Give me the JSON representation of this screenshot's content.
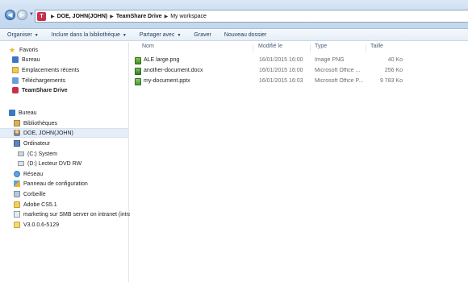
{
  "address": {
    "icon": "teamshare-icon",
    "crumbs": [
      "DOE, JOHN(JOHN)",
      "TeamShare Drive",
      "My workspace"
    ]
  },
  "toolbar": {
    "organise": "Organiser",
    "include_library": "Inclure dans la bibliothèque",
    "share_with": "Partager avec",
    "burn": "Graver",
    "new_folder": "Nouveau dossier"
  },
  "navigation": {
    "favorites": [
      {
        "label": "Favoris",
        "icon": "star-icon"
      },
      {
        "label": "Bureau",
        "icon": "desktop-icon"
      },
      {
        "label": "Emplacements récents",
        "icon": "recent-places-icon"
      },
      {
        "label": "Téléchargements",
        "icon": "downloads-icon"
      },
      {
        "label": "TeamShare Drive",
        "icon": "teamshare-icon"
      }
    ],
    "tree": [
      {
        "label": "Bureau",
        "icon": "desktop-icon"
      },
      {
        "label": "Bibliothèques",
        "icon": "libraries-icon"
      },
      {
        "label": "DOE, JOHN(JOHN)",
        "icon": "user-folder-icon"
      },
      {
        "label": "Ordinateur",
        "icon": "computer-icon"
      },
      {
        "label": "(C:) System",
        "icon": "drive-icon"
      },
      {
        "label": "(D:) Lecteur DVD RW",
        "icon": "dvd-drive-icon"
      },
      {
        "label": "Réseau",
        "icon": "network-icon"
      },
      {
        "label": "Panneau de configuration",
        "icon": "control-panel-icon"
      },
      {
        "label": "Corbeille",
        "icon": "recycle-bin-icon"
      },
      {
        "label": "Adobe CS5.1",
        "icon": "folder-icon"
      },
      {
        "label": "marketing sur SMB server on intranet (intra",
        "icon": "network-share-icon"
      },
      {
        "label": "V3.0.0.6-5129",
        "icon": "folder-icon"
      }
    ]
  },
  "file_list": {
    "columns": [
      "Nom",
      "Modifié le",
      "Type",
      "Taille"
    ],
    "files": [
      {
        "name": "ALE large.png",
        "modified": "16/01/2015 16:00",
        "type": "Image PNG",
        "size": "40 Ko",
        "icon": "png-file-icon"
      },
      {
        "name": "another-document.docx",
        "modified": "16/01/2015 16:00",
        "type": "Microsoft Office ...",
        "size": "256 Ko",
        "icon": "docx-file-icon"
      },
      {
        "name": "my-document.pptx",
        "modified": "16/01/2015 16:03",
        "type": "Microsoft Office P...",
        "size": "9 783 Ko",
        "icon": "pptx-file-icon"
      }
    ]
  },
  "colors": {
    "accent": "#c7304a",
    "selection": "#e5eef8",
    "toolbar_text": "#1e395b"
  }
}
